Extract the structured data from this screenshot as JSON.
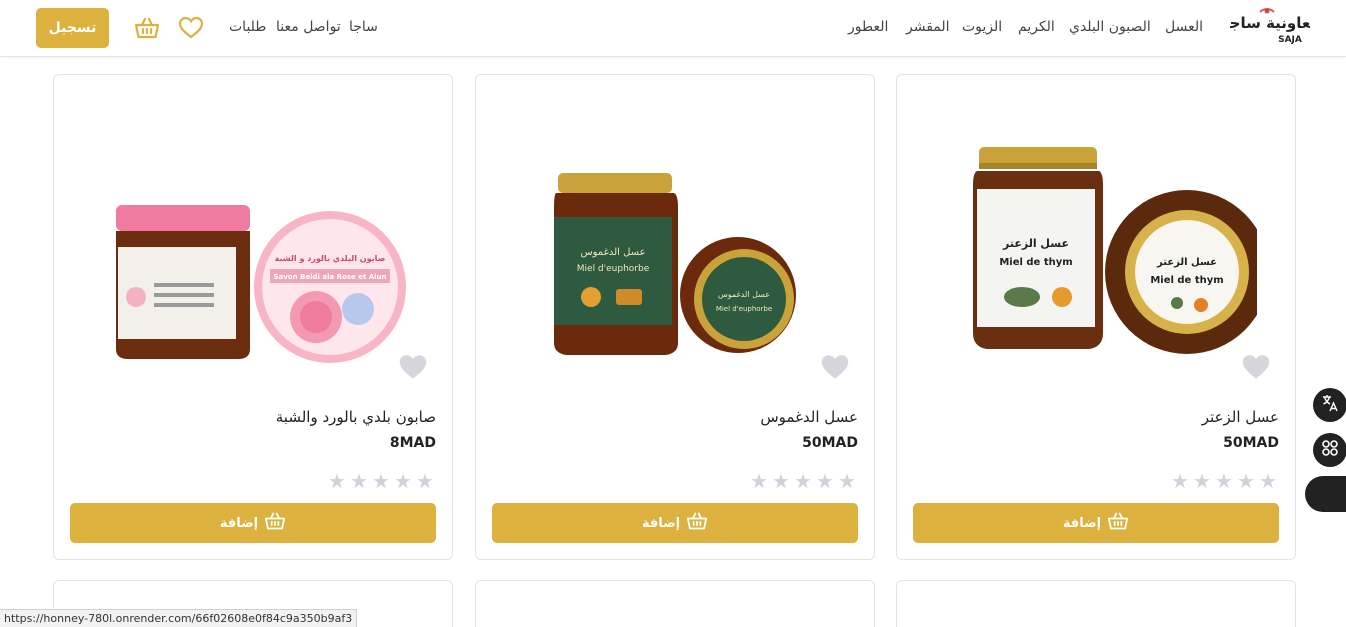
{
  "header": {
    "signup_label": "تسجيل",
    "left_links": [
      "طلبات",
      "تواصل معنا",
      "ساجا"
    ],
    "nav": [
      "العسل",
      "الصبون البلدي",
      "الكريم",
      "الزيوت",
      "المقشر",
      "العطور"
    ],
    "logo_text_ar": "تعاونية ساجا",
    "logo_text_en": "SAJA"
  },
  "products": [
    {
      "name": "عسل الزعتر",
      "price": "50MAD",
      "add_label": "إضافة",
      "rating": 0,
      "image_labels": [
        "عسل الزعتر",
        "Miel de thym"
      ]
    },
    {
      "name": "عسل الدغموس",
      "price": "50MAD",
      "add_label": "إضافة",
      "rating": 0,
      "image_labels": [
        "عسل الدغموس",
        "Miel d'euphorbe"
      ]
    },
    {
      "name": "صابون بلدي بالورد والشبة",
      "price": "8MAD",
      "add_label": "إضافة",
      "rating": 0,
      "image_labels": [
        "صابون البلدي بالورد و الشبة",
        "Savon Beldi ala Rose et Alun"
      ]
    }
  ],
  "status_url": "https://honney-780l.onrender.com/66f02608e0f84c9a350b9af3",
  "colors": {
    "accent": "#dcb13e",
    "star": "#d0d3dc"
  }
}
